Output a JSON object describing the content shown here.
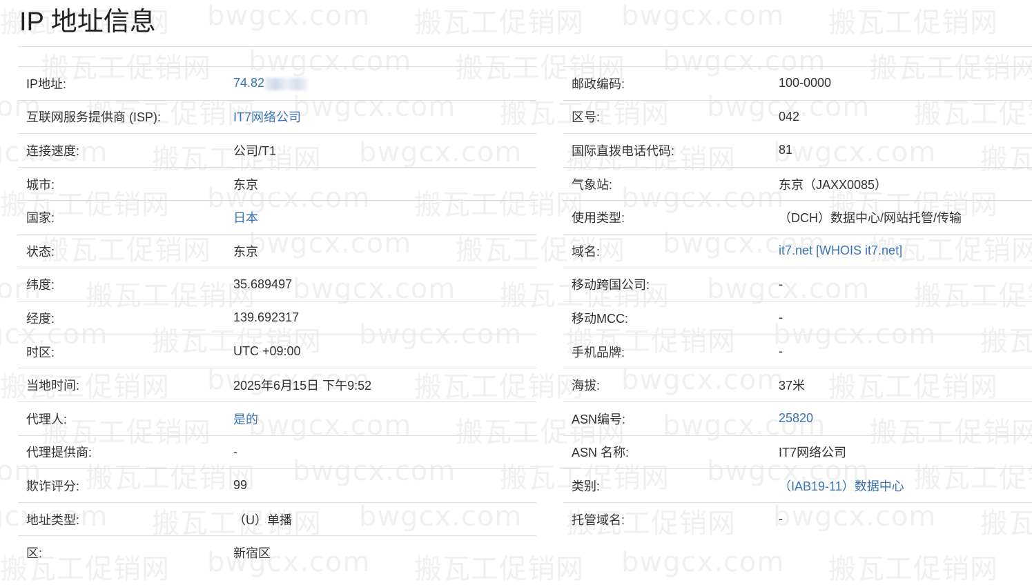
{
  "page": {
    "title": "IP 地址信息",
    "watermark_en": "bwgcx.com",
    "watermark_cn": "搬瓦工促销网",
    "link_color": "#3a72b8"
  },
  "left_rows": [
    {
      "label": "IP地址:",
      "value": "74.82",
      "link": true,
      "blurred": true
    },
    {
      "label": "互联网服务提供商 (ISP):",
      "value": "IT7网络公司",
      "link": true
    },
    {
      "label": "连接速度:",
      "value": "公司/T1",
      "link": false
    },
    {
      "label": "城市:",
      "value": "东京",
      "link": false
    },
    {
      "label": "国家:",
      "value": "日本",
      "link": true
    },
    {
      "label": "状态:",
      "value": "东京",
      "link": false
    },
    {
      "label": "纬度:",
      "value": "35.689497",
      "link": false
    },
    {
      "label": "经度:",
      "value": "139.692317",
      "link": false
    },
    {
      "label": "时区:",
      "value": "UTC +09:00",
      "link": false
    },
    {
      "label": "当地时间:",
      "value": "2025年6月15日 下午9:52",
      "link": false
    },
    {
      "label": "代理人:",
      "value": "是的",
      "link": true
    },
    {
      "label": "代理提供商:",
      "value": "-",
      "link": false
    },
    {
      "label": "欺诈评分:",
      "value": "99",
      "link": false
    },
    {
      "label": "地址类型:",
      "value": "（U）单播",
      "link": false
    },
    {
      "label": "区:",
      "value": "新宿区",
      "link": false
    }
  ],
  "right_rows": [
    {
      "label": "邮政编码:",
      "value": "100-0000",
      "link": false
    },
    {
      "label": "区号:",
      "value": "042",
      "link": false
    },
    {
      "label": "国际直拨电话代码:",
      "value": "81",
      "link": false
    },
    {
      "label": "气象站:",
      "value": "东京（JAXX0085）",
      "link": false
    },
    {
      "label": "使用类型:",
      "value": "（DCH）数据中心/网站托管/传输",
      "link": false
    },
    {
      "label": "域名:",
      "value": "it7.net [WHOIS it7.net]",
      "link": true
    },
    {
      "label": "移动跨国公司:",
      "value": "-",
      "link": false
    },
    {
      "label": "移动MCC:",
      "value": "-",
      "link": false
    },
    {
      "label": "手机品牌:",
      "value": "-",
      "link": false
    },
    {
      "label": "海拔:",
      "value": "37米",
      "link": false
    },
    {
      "label": "ASN编号:",
      "value": "25820",
      "link": true
    },
    {
      "label": "ASN 名称:",
      "value": "IT7网络公司",
      "link": false
    },
    {
      "label": "类别:",
      "value": "（IAB19-11）数据中心",
      "link": true
    },
    {
      "label": "托管域名:",
      "value": "-",
      "link": false
    }
  ]
}
